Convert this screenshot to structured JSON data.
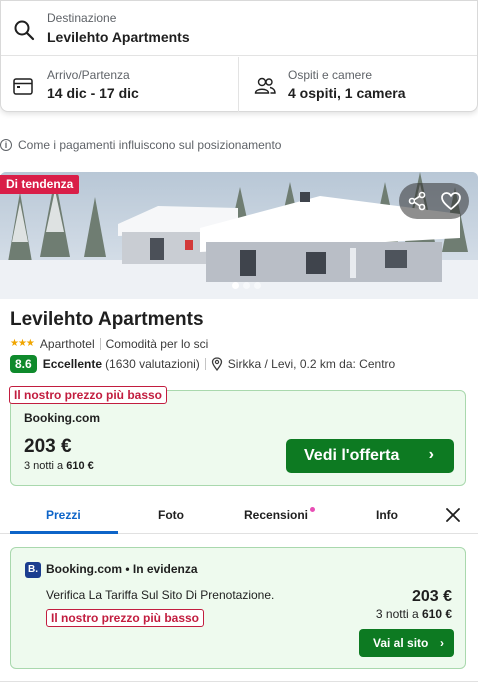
{
  "search": {
    "destination_label": "Destinazione",
    "destination_value": "Levilehto Apartments",
    "dates_label": "Arrivo/Partenza",
    "dates_value": "14 dic - 17 dic",
    "guests_label": "Ospiti e camere",
    "guests_value": "4 ospiti, 1 camera",
    "icons": [
      "search-icon",
      "calendar-icon",
      "guests-icon"
    ]
  },
  "info_line": "Come i pagamenti influiscono sul posizionamento",
  "hotel": {
    "badge": "Di tendenza",
    "name": "Levilehto Apartments",
    "stars": "★★★",
    "star_count": 3,
    "type": "Aparthotel",
    "amenity": "Comodità per lo sci",
    "score": "8.6",
    "score_word": "Eccellente",
    "reviews": "(1630 valutazioni)",
    "location": "Sirkka / Levi, 0.2 km da: Centro",
    "carousel_count": 3,
    "carousel_active": 1
  },
  "best_offer": {
    "tag": "Il nostro prezzo più basso",
    "provider": "Booking.com",
    "price": "203 €",
    "nights_prefix": "3 notti a",
    "nights_total": "610 €",
    "button": "Vedi l'offerta",
    "chevron": "›"
  },
  "tabs": [
    "Prezzi",
    "Foto",
    "Recensioni",
    "Info"
  ],
  "active_tab": "Prezzi",
  "provider_card": {
    "logo": "B.",
    "title": "Booking.com • In evidenza",
    "description": "Verifica La Tariffa Sul Sito Di Prenotazione.",
    "tag": "Il nostro prezzo più basso",
    "price": "203 €",
    "nights_prefix": "3 notti a",
    "nights_total": "610 €",
    "button": "Vai al sito",
    "chevron": "›"
  },
  "colors": {
    "accent_blue": "#0d64c8",
    "cta_green": "#0d7a22",
    "score_green": "#0f8a2c",
    "badge_red": "#d91e48",
    "card_bg": "#eefaee"
  }
}
